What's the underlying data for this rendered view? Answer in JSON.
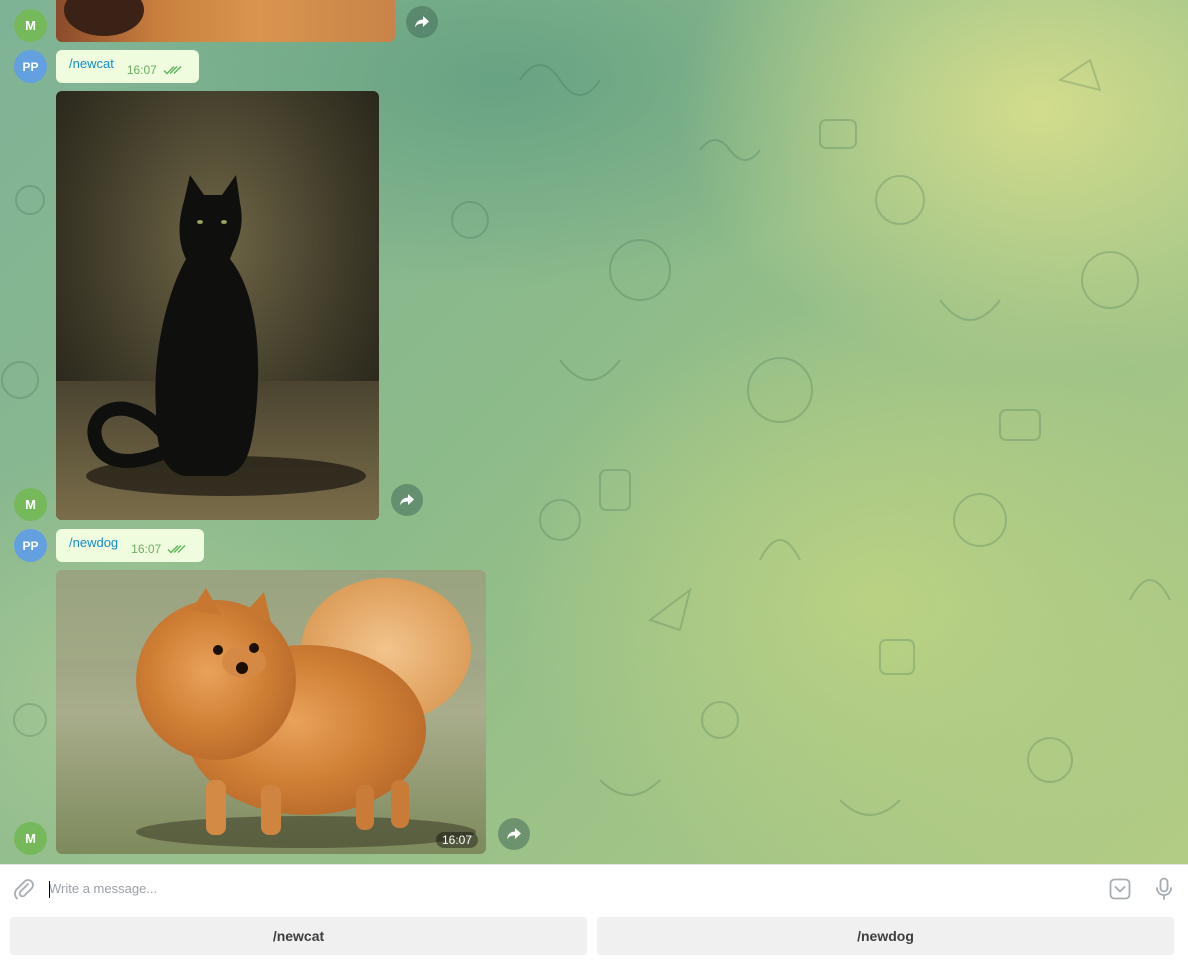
{
  "chat": {
    "messages": [
      {
        "avatar": "M",
        "type": "photo",
        "description": "partial photo (cut off at top)"
      },
      {
        "avatar": "PP",
        "type": "text",
        "text": "/newcat",
        "time": "16:07",
        "status": "read"
      },
      {
        "avatar": "M",
        "type": "photo",
        "description": "black cat painting"
      },
      {
        "avatar": "PP",
        "type": "text",
        "text": "/newdog",
        "time": "16:07",
        "status": "read"
      },
      {
        "avatar": "M",
        "type": "photo",
        "description": "pomeranian dog",
        "time": "16:07"
      }
    ]
  },
  "composer": {
    "placeholder": "Write a message..."
  },
  "keyboard": {
    "buttons": [
      {
        "label": "/newcat"
      },
      {
        "label": "/newdog"
      }
    ]
  },
  "colors": {
    "outgoing_bubble": "#effdde",
    "command_link": "#168acd",
    "time_text": "#6cae62",
    "avatar_m": "#75b95b",
    "avatar_pp": "#62a0e0"
  }
}
